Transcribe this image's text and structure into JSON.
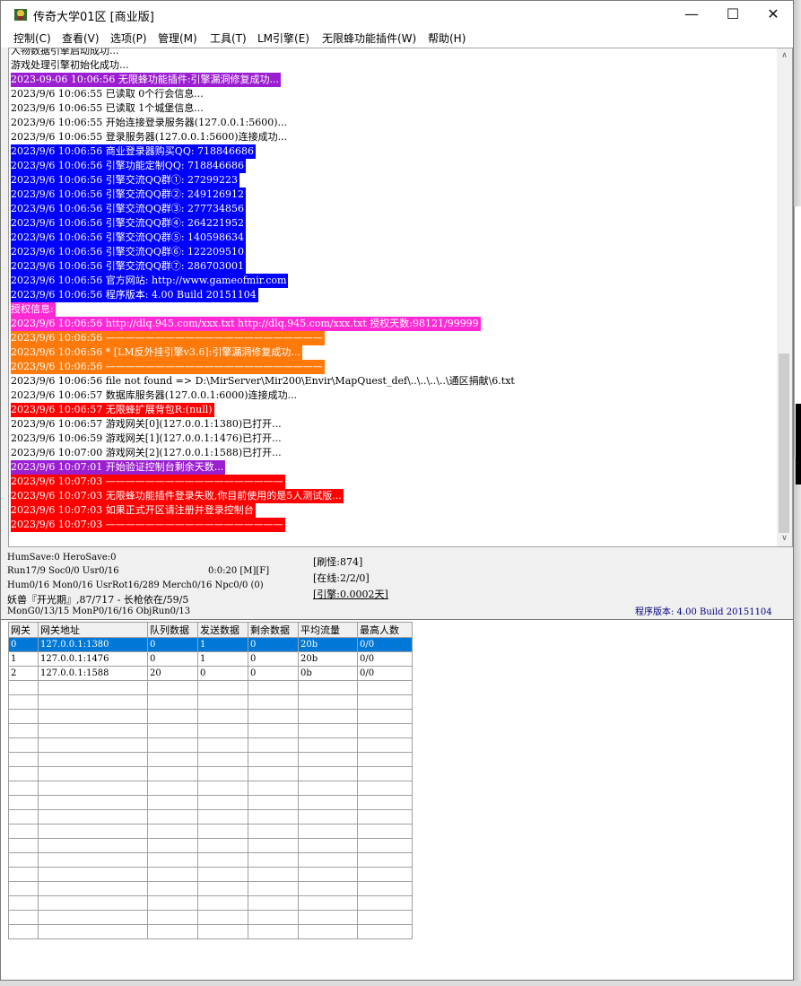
{
  "window": {
    "title": "传奇大学01区 [商业版]",
    "controls": {
      "minimize": "—",
      "maximize": "☐",
      "close": "✕"
    }
  },
  "menu": [
    {
      "label": "控制(C)"
    },
    {
      "label": "查看(V)"
    },
    {
      "label": "选项(P)"
    },
    {
      "label": "管理(M)"
    },
    {
      "label": "工具(T)"
    },
    {
      "label": "LM引擎(E)"
    },
    {
      "label": "无限蜂功能插件(W)"
    },
    {
      "label": "帮助(H)"
    }
  ],
  "log": [
    {
      "text": "人物数据引擎启动成功...",
      "bg": null,
      "fg": "#000000"
    },
    {
      "text": "游戏处理引擎初始化成功...",
      "bg": null,
      "fg": "#000000"
    },
    {
      "text": "2023-09-06 10:06:56 无限蜂功能插件:引擎漏洞修复成功...",
      "bg": "#9b1fd1",
      "fg": "#ffffff"
    },
    {
      "text": "2023/9/6 10:06:55 已读取 0个行会信息...",
      "bg": null,
      "fg": "#000000"
    },
    {
      "text": "2023/9/6 10:06:55 已读取 1个城堡信息...",
      "bg": null,
      "fg": "#000000"
    },
    {
      "text": "2023/9/6 10:06:55 开始连接登录服务器(127.0.0.1:5600)...",
      "bg": null,
      "fg": "#000000"
    },
    {
      "text": "2023/9/6 10:06:55 登录服务器(127.0.0.1:5600)连接成功...",
      "bg": null,
      "fg": "#000000"
    },
    {
      "text": "2023/9/6 10:06:56 商业登录器购买QQ: 718846686",
      "bg": "#0000ff",
      "fg": "#ffffff"
    },
    {
      "text": "2023/9/6 10:06:56 引擎功能定制QQ: 718846686",
      "bg": "#0000ff",
      "fg": "#ffffff"
    },
    {
      "text": "2023/9/6 10:06:56 引擎交流QQ群①: 27299223",
      "bg": "#0000ff",
      "fg": "#ffffff"
    },
    {
      "text": "2023/9/6 10:06:56 引擎交流QQ群②: 249126912",
      "bg": "#0000ff",
      "fg": "#ffffff"
    },
    {
      "text": "2023/9/6 10:06:56 引擎交流QQ群③: 277734856",
      "bg": "#0000ff",
      "fg": "#ffffff"
    },
    {
      "text": "2023/9/6 10:06:56 引擎交流QQ群④: 264221952",
      "bg": "#0000ff",
      "fg": "#ffffff"
    },
    {
      "text": "2023/9/6 10:06:56 引擎交流QQ群⑤: 140598634",
      "bg": "#0000ff",
      "fg": "#ffffff"
    },
    {
      "text": "2023/9/6 10:06:56 引擎交流QQ群⑥: 122209510",
      "bg": "#0000ff",
      "fg": "#ffffff"
    },
    {
      "text": "2023/9/6 10:06:56 引擎交流QQ群⑦: 286703001",
      "bg": "#0000ff",
      "fg": "#ffffff"
    },
    {
      "text": "2023/9/6 10:06:56 官方网站: http://www.gameofmir.com",
      "bg": "#0000ff",
      "fg": "#ffffff"
    },
    {
      "text": "2023/9/6 10:06:56 程序版本: 4.00 Build 20151104",
      "bg": "#0000ff",
      "fg": "#ffffff"
    },
    {
      "text": "授权信息:",
      "bg": "#ff2ad4",
      "fg": "#ffffff"
    },
    {
      "text": "2023/9/6 10:06:56 http://dlq.945.com/xxx.txt http://dlq.945.com/xxx.txt 授权天数:98121/99999",
      "bg": "#ff2ad4",
      "fg": "#ffffff"
    },
    {
      "text": "2023/9/6 10:06:56 ——————————————————————",
      "bg": "#ff7a0a",
      "fg": "#ffffff"
    },
    {
      "text": "2023/9/6 10:06:56 * [LM反外挂引擎v3.6]:引擎漏洞修复成功...",
      "bg": "#ff7a0a",
      "fg": "#ffffff"
    },
    {
      "text": "2023/9/6 10:06:56 ——————————————————————",
      "bg": "#ff7a0a",
      "fg": "#ffffff"
    },
    {
      "text": "2023/9/6 10:06:56 file not found => D:\\MirServer\\Mir200\\Envir\\MapQuest_def\\..\\..\\..\\..\\通区捐献\\6.txt",
      "bg": null,
      "fg": "#000000"
    },
    {
      "text": "2023/9/6 10:06:57 数据库服务器(127.0.0.1:6000)连接成功...",
      "bg": null,
      "fg": "#000000"
    },
    {
      "text": "2023/9/6 10:06:57 无限蜂扩展背包R:(null)",
      "bg": "#ff0000",
      "fg": "#ffffff"
    },
    {
      "text": "2023/9/6 10:06:57 游戏网关[0](127.0.0.1:1380)已打开...",
      "bg": null,
      "fg": "#000000"
    },
    {
      "text": "2023/9/6 10:06:59 游戏网关[1](127.0.0.1:1476)已打开...",
      "bg": null,
      "fg": "#000000"
    },
    {
      "text": "2023/9/6 10:07:00 游戏网关[2](127.0.0.1:1588)已打开...",
      "bg": null,
      "fg": "#000000"
    },
    {
      "text": "2023/9/6 10:07:01 开始验证控制台剩余天数...",
      "bg": "#9b1fd1",
      "fg": "#ffffff"
    },
    {
      "text": "2023/9/6 10:07:03 ——————————————————",
      "bg": "#ff0000",
      "fg": "#ffffff"
    },
    {
      "text": "2023/9/6 10:07:03 无限蜂功能插件登录失败,你目前使用的是5人测试版...",
      "bg": "#ff0000",
      "fg": "#ffffff"
    },
    {
      "text": "2023/9/6 10:07:03 如果正式开区请注册并登录控制台",
      "bg": "#ff0000",
      "fg": "#ffffff"
    },
    {
      "text": "2023/9/6 10:07:03 ——————————————————",
      "bg": "#ff0000",
      "fg": "#ffffff"
    }
  ],
  "scrollbar": {
    "up": "∧",
    "down": "∨"
  },
  "stats": {
    "hum_save": "HumSave:0 HeroSave:0",
    "run": "Run17/9 Soc0/0 Usr0/16",
    "timer": "0:0:20 [M][F]",
    "mon": "Hum0/16 Mon0/16 UsrRot16/289 Merch0/16 Npc0/0 (0)",
    "boss": "妖兽『开光期』,87/717 - 长枪依在/59/5",
    "objrun": "MonG0/13/15 MonP0/16/16 ObjRun0/13",
    "refresh": "[刷怪:874]",
    "online": "[在线:2/2/0]",
    "engine": "[引擎:0.0002天]",
    "version": "程序版本: 4.00 Build 20151104"
  },
  "colors": {
    "accent_blue": "#0000ff",
    "version_text": "#000080",
    "selection": "#0078d7"
  },
  "gate_table": {
    "columns": [
      "网关",
      "网关地址",
      "队列数据",
      "发送数据",
      "剩余数据",
      "平均流量",
      "最高人数"
    ],
    "rows": [
      [
        "0",
        "127.0.0.1:1380",
        "0",
        "1",
        "0",
        "20b",
        "0/0"
      ],
      [
        "1",
        "127.0.0.1:1476",
        "0",
        "1",
        "0",
        "20b",
        "0/0"
      ],
      [
        "2",
        "127.0.0.1:1588",
        "20",
        "0",
        "0",
        "0b",
        "0/0"
      ]
    ],
    "selected_row": 0
  }
}
